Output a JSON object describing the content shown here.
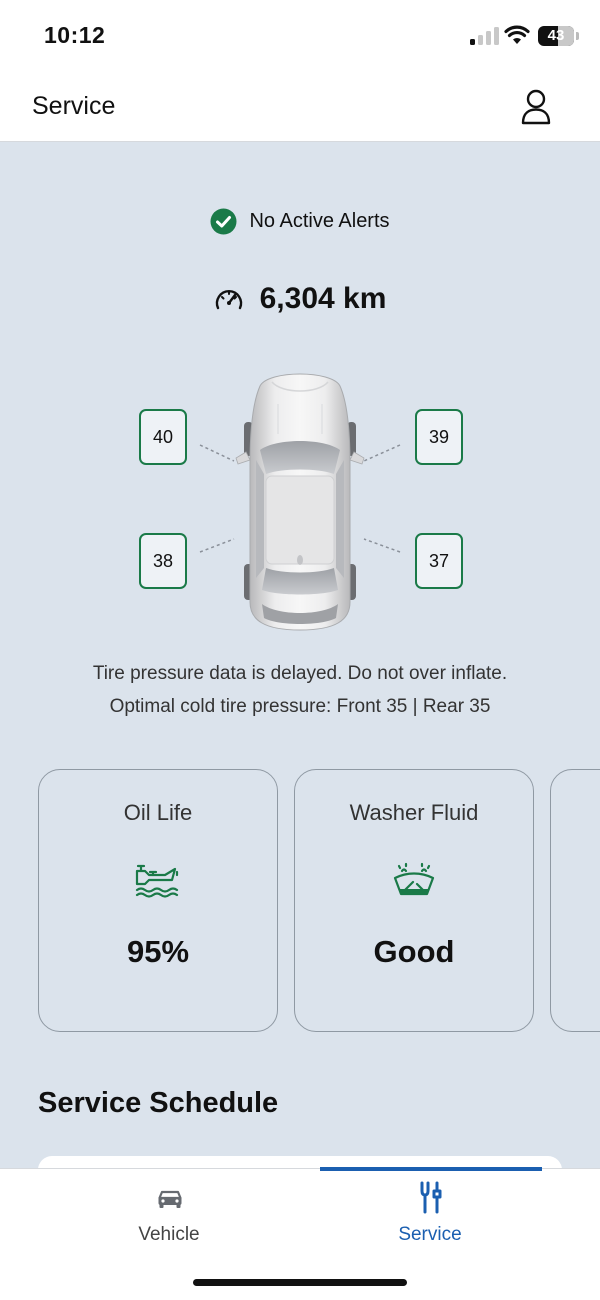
{
  "status_bar": {
    "time": "10:12",
    "battery": "43"
  },
  "header": {
    "title": "Service",
    "profile_icon": "person-icon"
  },
  "alerts": {
    "text": "No Active Alerts",
    "icon": "check-circle-icon",
    "color": "#1a7a48"
  },
  "odometer": {
    "value": "6,304 km",
    "icon": "speedometer-icon"
  },
  "tires": {
    "front_left": "40",
    "front_right": "39",
    "rear_left": "38",
    "rear_right": "37",
    "note_line1": "Tire pressure data is delayed. Do not over inflate.",
    "note_line2": "Optimal cold tire pressure: Front 35 | Rear 35"
  },
  "cards": [
    {
      "title": "Oil Life",
      "value": "95%",
      "icon": "oil-can-icon"
    },
    {
      "title": "Washer Fluid",
      "value": "Good",
      "icon": "washer-fluid-icon"
    }
  ],
  "schedule": {
    "title": "Service Schedule"
  },
  "nav": {
    "vehicle_label": "Vehicle",
    "service_label": "Service",
    "active": "service",
    "active_color": "#1b5fb0"
  }
}
